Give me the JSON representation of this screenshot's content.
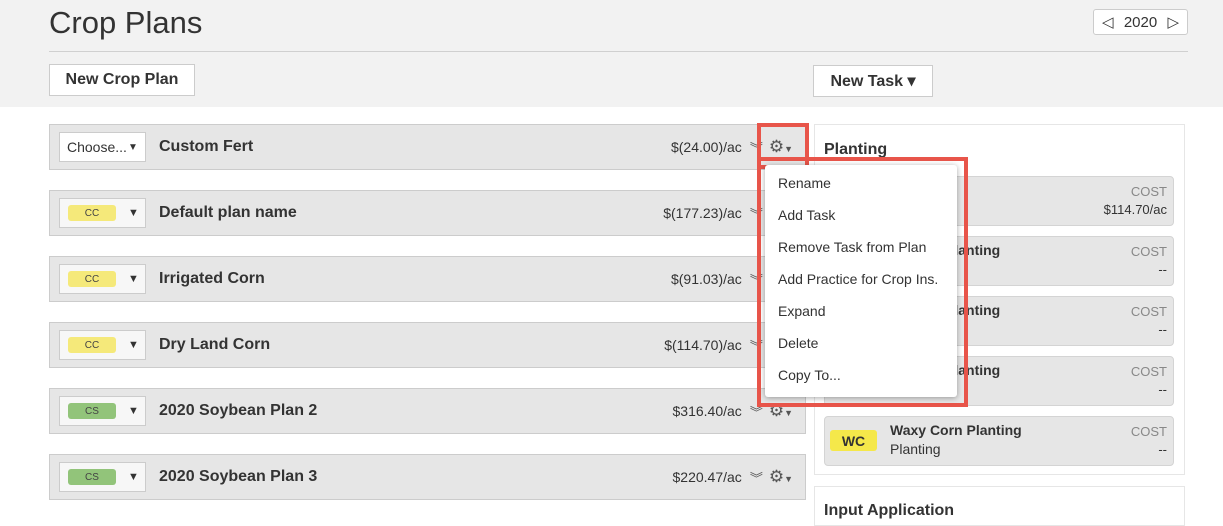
{
  "header": {
    "title": "Crop Plans",
    "year": "2020",
    "prev_icon": "triangle-left",
    "next_icon": "triangle-right",
    "new_crop_plan": "New Crop Plan",
    "new_task": "New Task ▾"
  },
  "plans": [
    {
      "select": "Choose...",
      "badge": "",
      "name": "Custom Fert",
      "cost": "$(24.00)/ac"
    },
    {
      "select": "",
      "badge": "CC",
      "badge_color": "#f5e97a",
      "name": "Default plan name",
      "cost": "$(177.23)/ac"
    },
    {
      "select": "",
      "badge": "CC",
      "badge_color": "#f5e97a",
      "name": "Irrigated Corn",
      "cost": "$(91.03)/ac"
    },
    {
      "select": "",
      "badge": "CC",
      "badge_color": "#f5e97a",
      "name": "Dry Land Corn",
      "cost": "$(114.70)/ac"
    },
    {
      "select": "",
      "badge": "CS",
      "badge_color": "#92c47a",
      "name": "2020 Soybean Plan 2",
      "cost": "$316.40/ac"
    },
    {
      "select": "",
      "badge": "CS",
      "badge_color": "#92c47a",
      "name": "2020 Soybean Plan 3",
      "cost": "$220.47/ac"
    }
  ],
  "menu": {
    "items": [
      "Rename",
      "Add Task",
      "Remove Task from Plan",
      "Add Practice for Crop Ins.",
      "Expand",
      "Delete",
      "Copy To..."
    ]
  },
  "panel": {
    "title": "Planting",
    "cards": [
      {
        "name": "",
        "cost_label": "COST",
        "cost": "$114.70/ac"
      },
      {
        "name": "Planting",
        "cost_label": "COST",
        "cost": "--"
      },
      {
        "name": "Planting",
        "cost_label": "COST",
        "cost": "--"
      },
      {
        "name": "Planting",
        "cost_label": "COST",
        "cost": "--"
      },
      {
        "badge": "WC",
        "name": "Waxy Corn Planting",
        "sub": "Planting",
        "cost_label": "COST",
        "cost": "--"
      }
    ]
  },
  "panel2": {
    "title": "Input Application"
  },
  "colors": {
    "highlight": "#e8554a",
    "wc": "#f5e84a"
  }
}
